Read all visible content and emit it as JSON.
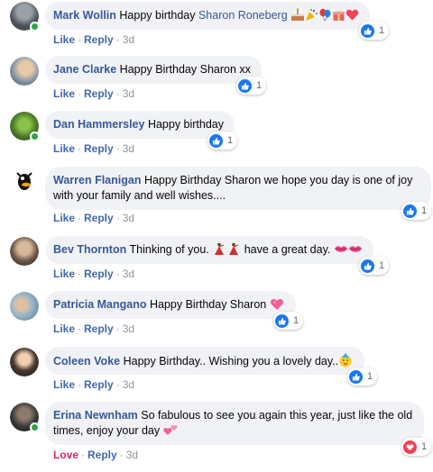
{
  "comments": [
    {
      "author": "Mark Wollin",
      "text": "Happy birthday",
      "tag": "Sharon Roneberg",
      "emojis": [
        "cake-icon",
        "party-popper-icon",
        "balloons-icon",
        "gift-icon",
        "heart-icon"
      ],
      "action": "Like",
      "reply": "Reply",
      "time": "3d",
      "reaction": "like",
      "count": "1"
    },
    {
      "author": "Jane Clarke",
      "text": "Happy Birthday Sharon xx",
      "action": "Like",
      "reply": "Reply",
      "time": "3d",
      "reaction": "like",
      "count": "1"
    },
    {
      "author": "Dan Hammersley",
      "text": "Happy birthday",
      "action": "Like",
      "reply": "Reply",
      "time": "3d",
      "reaction": "like",
      "count": "1"
    },
    {
      "author": "Warren Flanigan",
      "text": "Happy Birthday Sharon we hope you day is one of joy with your family and well wishes....",
      "action": "Like",
      "reply": "Reply",
      "time": "3d",
      "reaction": "like",
      "count": "1"
    },
    {
      "author": "Bev Thornton",
      "text": "Thinking of you.",
      "text2": "have a great day.",
      "emojis": [
        "dancer-icon",
        "dancer-icon"
      ],
      "emojis2": [
        "kiss-lips-icon",
        "kiss-lips-icon"
      ],
      "action": "Like",
      "reply": "Reply",
      "time": "3d",
      "reaction": "like",
      "count": "1"
    },
    {
      "author": "Patricia Mangano",
      "text": "Happy Birthday Sharon",
      "emojis": [
        "sparkling-heart-icon"
      ],
      "action": "Like",
      "reply": "Reply",
      "time": "3d",
      "reaction": "like",
      "count": "1"
    },
    {
      "author": "Coleen Voke",
      "text": "Happy Birthday.. Wishing you a lovely day..",
      "emojis": [
        "partying-face-icon"
      ],
      "action": "Like",
      "reply": "Reply",
      "time": "3d",
      "reaction": "like",
      "count": "1"
    },
    {
      "author": "Erina Newnham",
      "text": "So fabulous to see you again this year, just like the old times, enjoy your day",
      "emojis": [
        "two-hearts-icon"
      ],
      "action": "Love",
      "reply": "Reply",
      "time": "3d",
      "reaction": "love",
      "count": "1"
    }
  ],
  "colors": {
    "link": "#385898",
    "like": "#1877f2",
    "love": "#f33e58",
    "bubble": "#f0f2f5",
    "online": "#31a24c"
  }
}
